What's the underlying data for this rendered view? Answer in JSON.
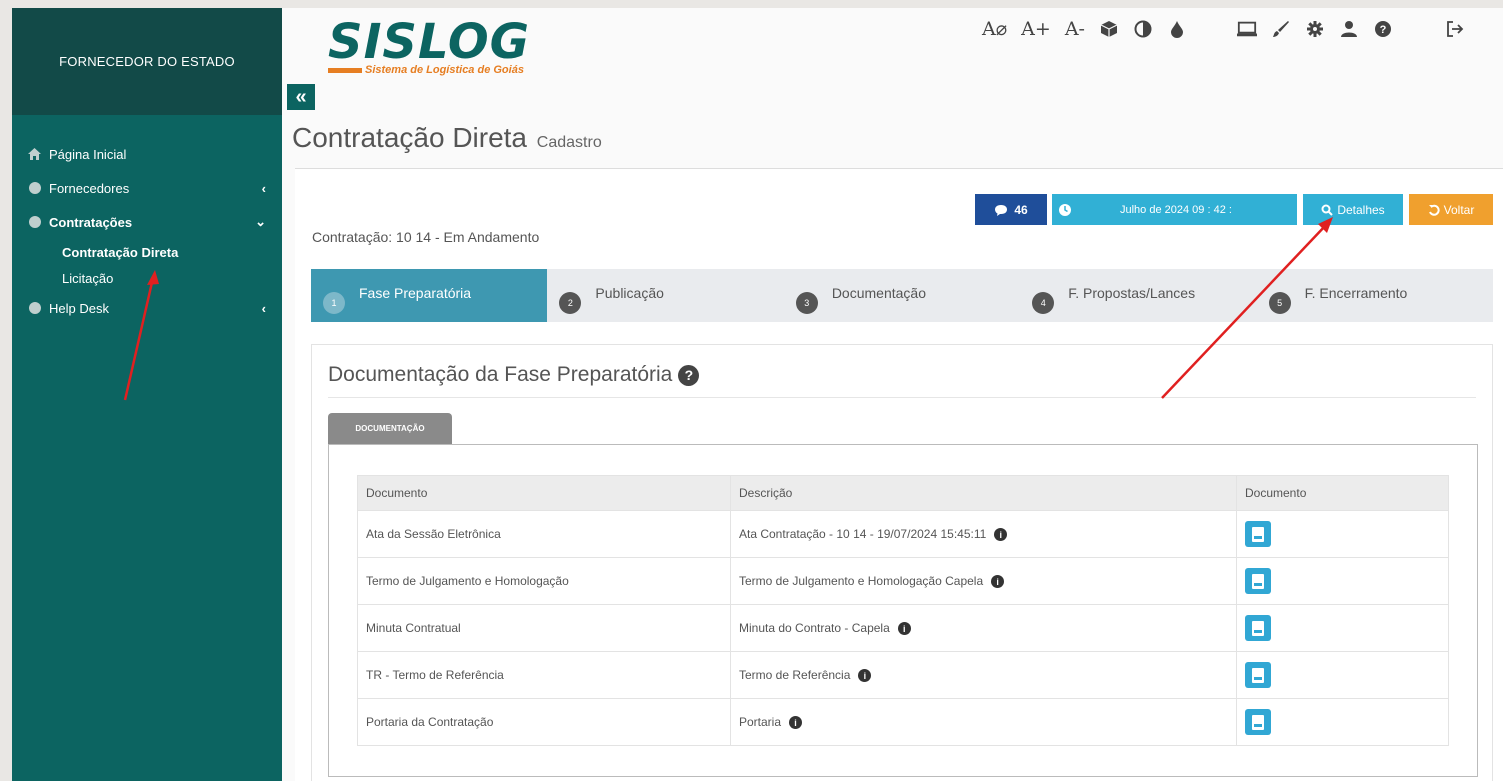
{
  "sidebar": {
    "header": "FORNECEDOR DO ESTADO",
    "items": [
      {
        "label": "Página Inicial",
        "icon": "home-icon"
      },
      {
        "label": "Fornecedores",
        "icon": "circle-icon",
        "chevron": "‹"
      },
      {
        "label": "Contratações",
        "icon": "circle-icon",
        "chevron": "⌄"
      },
      {
        "label": "Help Desk",
        "icon": "circle-icon",
        "chevron": "‹"
      }
    ],
    "submenu": [
      "Contratação Direta",
      "Licitação"
    ]
  },
  "logo": {
    "title": "SISLOG",
    "subtitle": "Sistema de Logística de Goiás"
  },
  "toolbar": {
    "font_toggle": "A⌀",
    "font_increase": "A+",
    "font_decrease": "A-"
  },
  "page": {
    "title": "Contratação Direta",
    "subtitle": "Cadastro"
  },
  "contract": {
    "label": "Contratação: 10  14  - Em Andamento"
  },
  "buttons": {
    "messages_count": "46",
    "date": "Julho de 2024 09 : 42 :",
    "details": "Detalhes",
    "back": "Voltar"
  },
  "steps": [
    {
      "num": "1",
      "label": "Fase Preparatória"
    },
    {
      "num": "2",
      "label": "Publicação"
    },
    {
      "num": "3",
      "label": "Documentação"
    },
    {
      "num": "4",
      "label": "F. Propostas/Lances"
    },
    {
      "num": "5",
      "label": "F. Encerramento"
    }
  ],
  "documentation": {
    "title": "Documentação da Fase Preparatória",
    "tab": "DOCUMENTAÇÃO",
    "columns": [
      "Documento",
      "Descrição",
      "Documento"
    ],
    "rows": [
      {
        "documento": "Ata da Sessão Eletrônica",
        "descricao": "Ata Contratação - 10  14  - 19/07/2024 15:45:11"
      },
      {
        "documento": "Termo de Julgamento e Homologação",
        "descricao": "Termo de Julgamento e Homologação Capela"
      },
      {
        "documento": "Minuta Contratual",
        "descricao": "Minuta do Contrato - Capela"
      },
      {
        "documento": "TR - Termo de Referência",
        "descricao": "Termo de Referência"
      },
      {
        "documento": "Portaria da Contratação",
        "descricao": "Portaria"
      }
    ]
  },
  "colors": {
    "sidebar": "#0c6461",
    "sidebar_header": "#124a48",
    "active_step": "#3e98b1",
    "info_button": "#31b0d5",
    "warning_button": "#f0a02e",
    "primary_button": "#1f4e9a",
    "annotation_arrow": "#e02020"
  }
}
